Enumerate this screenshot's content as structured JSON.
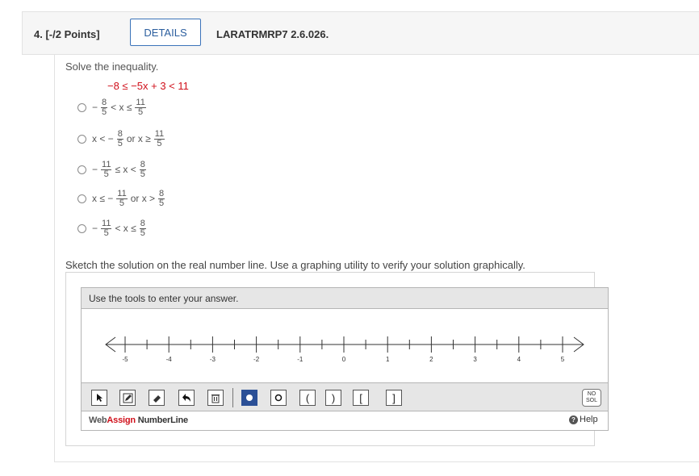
{
  "header": {
    "question_label": "4. [-/2 Points]",
    "details_label": "DETAILS",
    "question_code": "LARATRMRP7 2.6.026."
  },
  "problem": {
    "prompt": "Solve the inequality.",
    "inequality": "−8 ≤ −5x + 3 < 11"
  },
  "choices": [
    {
      "pre": "−",
      "f1n": "8",
      "f1d": "5",
      "mid": "< x ≤",
      "pre2": "",
      "f2n": "11",
      "f2d": "5"
    },
    {
      "pre": "x < −",
      "f1n": "8",
      "f1d": "5",
      "mid": "or x ≥",
      "pre2": "",
      "f2n": "11",
      "f2d": "5"
    },
    {
      "pre": "−",
      "f1n": "11",
      "f1d": "5",
      "mid": "≤ x <",
      "pre2": "",
      "f2n": "8",
      "f2d": "5"
    },
    {
      "pre": "x ≤ −",
      "f1n": "11",
      "f1d": "5",
      "mid": "or x >",
      "pre2": "",
      "f2n": "8",
      "f2d": "5"
    },
    {
      "pre": "−",
      "f1n": "11",
      "f1d": "5",
      "mid": "< x ≤",
      "pre2": "",
      "f2n": "8",
      "f2d": "5"
    }
  ],
  "sketch_instruction": "Sketch the solution on the real number line. Use a graphing utility to verify your solution graphically.",
  "numberline": {
    "title": "Use the tools to enter your answer.",
    "ticks": [
      "-5",
      "-4",
      "-3",
      "-2",
      "-1",
      "0",
      "1",
      "2",
      "3",
      "4",
      "5"
    ],
    "tools": [
      {
        "name": "pointer-tool",
        "icon": "pointer-icon"
      },
      {
        "name": "pencil-tool",
        "icon": "pencil-icon"
      },
      {
        "name": "eraser-tool",
        "icon": "eraser-icon"
      },
      {
        "name": "undo-tool",
        "icon": "undo-icon"
      },
      {
        "name": "trash-tool",
        "icon": "trash-icon"
      },
      {
        "name": "closed-point-tool",
        "icon": "filled-dot-icon"
      },
      {
        "name": "open-point-tool",
        "icon": "open-dot-icon"
      },
      {
        "name": "left-paren-tool",
        "label": "("
      },
      {
        "name": "right-paren-tool",
        "label": ")"
      },
      {
        "name": "left-bracket-tool",
        "label": "["
      },
      {
        "name": "right-bracket-tool",
        "label": "]"
      }
    ],
    "no_sol_line1": "NO",
    "no_sol_line2": "SOL",
    "brand_web": "Web",
    "brand_assign": "Assign",
    "brand_product": " NumberLine",
    "help_label": "Help",
    "colors": {
      "brand_red": "#d0101b",
      "selected_tool": "#2a4f96"
    }
  }
}
